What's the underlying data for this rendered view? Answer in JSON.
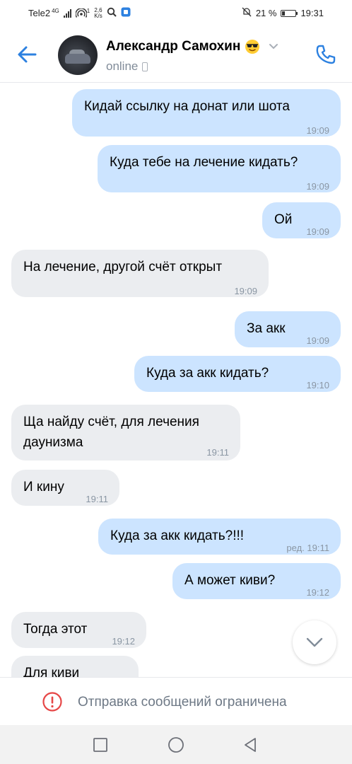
{
  "status_bar": {
    "carrier": "Tele2",
    "network": "4G",
    "hotspot_count": "1",
    "speed_value": "2,6",
    "speed_unit": "K/s",
    "battery": "21 %",
    "battery_level": 0.21,
    "time": "19:31"
  },
  "header": {
    "name": "Александр Самохин",
    "status": "online",
    "name_emoji": "sunglasses-emoji-icon"
  },
  "messages": [
    {
      "dir": "out",
      "text": "Кидай ссылку на донат или шота",
      "time": "19:09"
    },
    {
      "dir": "out",
      "text": "Куда тебе на лечение кидать?",
      "time": "19:09"
    },
    {
      "dir": "out",
      "text": "Ой",
      "time": "19:09"
    },
    {
      "dir": "in",
      "text": "На лечение, другой счёт открыт",
      "time": "19:09"
    },
    {
      "dir": "out",
      "text": "За акк",
      "time": "19:09"
    },
    {
      "dir": "out",
      "text": "Куда за акк кидать?",
      "time": "19:10"
    },
    {
      "dir": "in",
      "text_line1": "Ща найду счёт, для лечения",
      "text_line2": "даунизма",
      "time": "19:11"
    },
    {
      "dir": "in",
      "text": "И кину",
      "time": "19:11"
    },
    {
      "dir": "out",
      "text": "Куда за акк кидать?!!!",
      "edited": "ред.",
      "time": "19:11"
    },
    {
      "dir": "out",
      "text": "А может киви?",
      "time": "19:12"
    },
    {
      "dir": "in",
      "text": "Тогда этот",
      "time": "19:12"
    },
    {
      "dir": "in",
      "text": "Для киви"
    }
  ],
  "restriction": {
    "text": "Отправка сообщений ограничена"
  },
  "colors": {
    "accent": "#2d81e0",
    "outgoing_bubble": "#cce4ff",
    "incoming_bubble": "#ebedf0",
    "alert": "#e64646"
  }
}
